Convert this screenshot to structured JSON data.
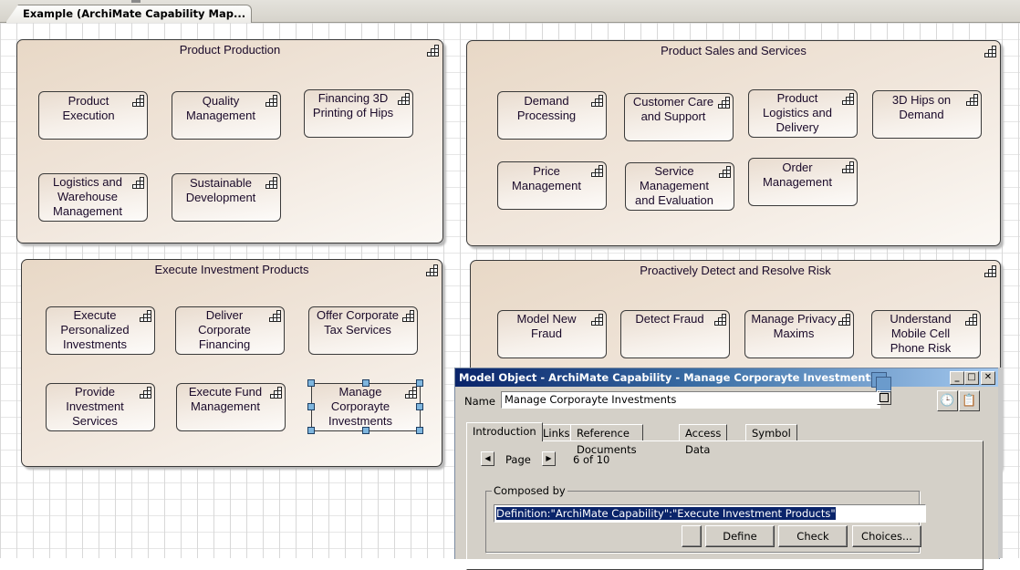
{
  "document_tab": {
    "label": "Example (ArchiMate Capability Map..."
  },
  "groups": [
    {
      "title": "Product Production",
      "capabilities": [
        "Product Execution",
        "Quality Management",
        "Financing 3D Printing of Hips",
        "Logistics and Warehouse Management",
        "Sustainable Development"
      ]
    },
    {
      "title": "Product Sales and Services",
      "capabilities": [
        "Demand Processing",
        "Customer Care and Support",
        "Product Logistics and Delivery",
        "3D Hips on Demand",
        "Price Management",
        "Service Management and Evaluation",
        "Order Management"
      ]
    },
    {
      "title": "Execute Investment Products",
      "capabilities": [
        "Execute Personalized Investments",
        "Deliver Corporate Financing",
        "Offer Corporate Tax Services",
        "Provide Investment Services",
        "Execute Fund Management",
        "Manage Corporayte Investments"
      ]
    },
    {
      "title": "Proactively Detect and Resolve Risk",
      "capabilities": [
        "Model New Fraud",
        "Detect Fraud",
        "Manage Privacy Maxims",
        "Understand Mobile Cell Phone Risk"
      ]
    }
  ],
  "capability_icon": "capability-staircase-icon",
  "selected_capability": "Manage Corporayte Investments",
  "dialog": {
    "title": "Model Object - ArchiMate Capability - Manage Corporayte Investments",
    "window_buttons": {
      "minimize": "_",
      "maximize": "□",
      "close": "✕"
    },
    "name_label": "Name",
    "name_value": "Manage Corporayte Investments",
    "tabs": [
      "Introduction",
      "Links",
      "Reference Documents",
      "Access Data",
      "Symbol"
    ],
    "active_tab": "Introduction",
    "page_label": "Page",
    "page_indicator": "6 of 10",
    "composed_by_label": "Composed by",
    "composed_by_value": "Definition:\"ArchiMate Capability\":\"Execute Investment Products\"",
    "buttons": {
      "blank": "",
      "define": "Define",
      "check": "Check",
      "choices": "Choices..."
    }
  }
}
